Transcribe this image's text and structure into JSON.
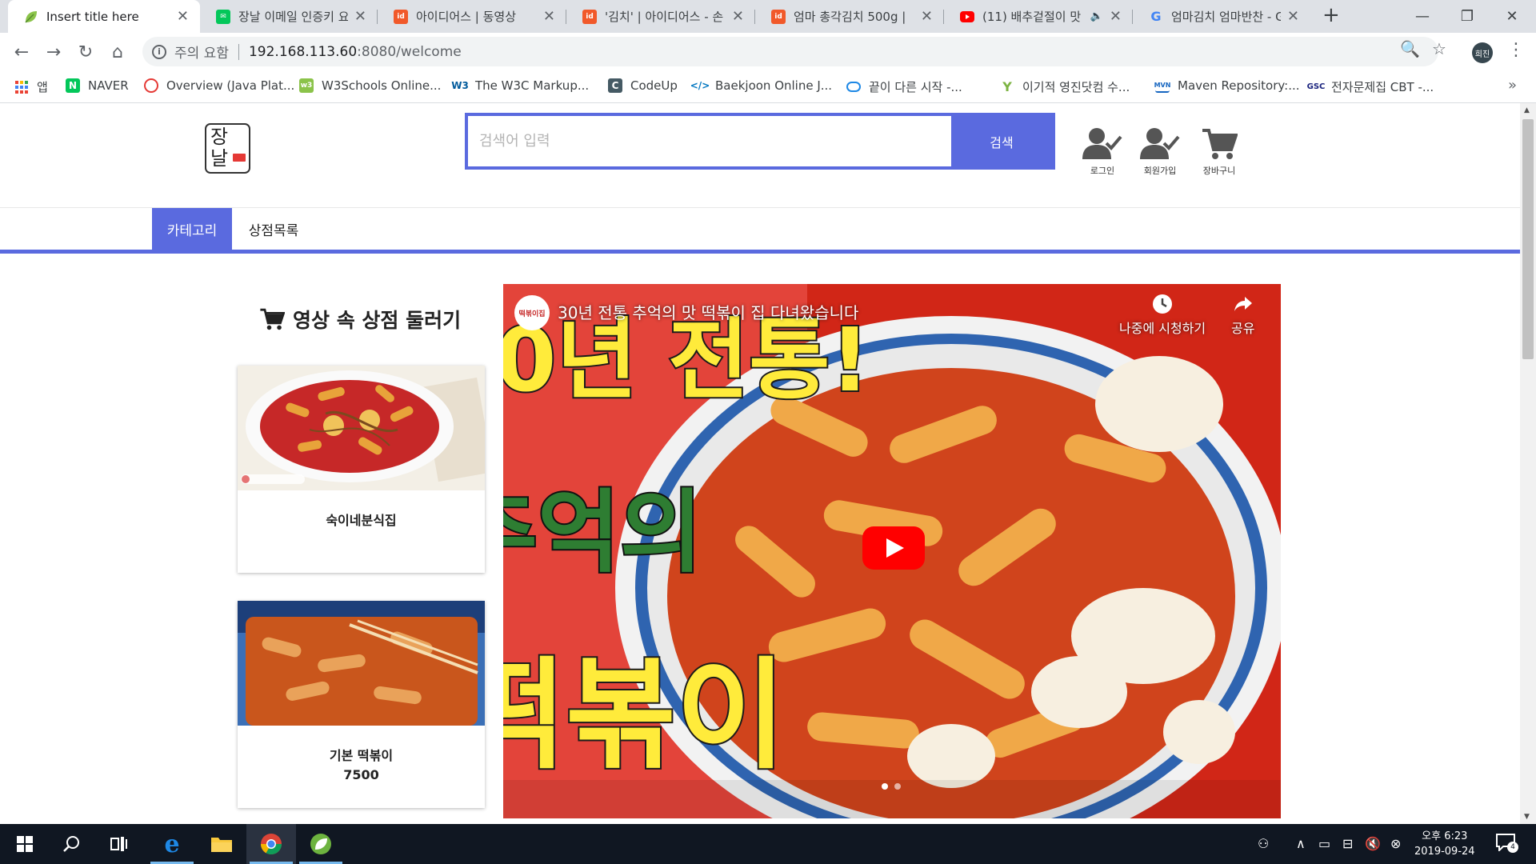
{
  "browser": {
    "tabs": [
      {
        "title": "Insert title here",
        "icon": "leaf-icon",
        "active": true
      },
      {
        "title": "장날 이메일 인증키 요",
        "icon": "naver-icon"
      },
      {
        "title": "아이디어스 | 동영상",
        "icon": "idus-icon"
      },
      {
        "title": "'김치' | 아이디어스 - 손",
        "icon": "idus-icon"
      },
      {
        "title": "엄마 총각김치 500g |",
        "icon": "idus-icon"
      },
      {
        "title": "(11) 배추겉절이 맛",
        "icon": "youtube-icon"
      },
      {
        "title": "엄마김치 엄마반찬 - G",
        "icon": "google-icon"
      }
    ],
    "address": {
      "warning": "주의 요함",
      "host": "192.168.113.60",
      "path": ":8080/welcome"
    },
    "profile_initials": "희진",
    "bookmarks": [
      {
        "label": "앱",
        "icon": "apps-grid-icon"
      },
      {
        "label": "NAVER",
        "icon": "naver-icon"
      },
      {
        "label": "Overview (Java Plat...",
        "icon": "oracle-icon"
      },
      {
        "label": "W3Schools Online...",
        "icon": "w3schools-icon"
      },
      {
        "label": "The W3C Markup...",
        "icon": "w3c-icon"
      },
      {
        "label": "CodeUp",
        "icon": "codeup-icon"
      },
      {
        "label": "Baekjoon Online J...",
        "icon": "code-brackets-icon"
      },
      {
        "label": "끝이 다른 시작 -...",
        "icon": "chat-bubble-icon"
      },
      {
        "label": "이기적 영진닷컴 수...",
        "icon": "y-icon"
      },
      {
        "label": "Maven Repository:...",
        "icon": "mvn-icon"
      },
      {
        "label": "전자문제집 CBT -...",
        "icon": "gsc-icon"
      }
    ]
  },
  "site": {
    "logo_text": [
      "장",
      "날"
    ],
    "search": {
      "placeholder": "검색어 입력",
      "button": "검색"
    },
    "header_icons": [
      {
        "label": "로그인",
        "icon": "user-check-icon"
      },
      {
        "label": "회원가입",
        "icon": "user-check-icon"
      },
      {
        "label": "장바구니",
        "icon": "cart-icon"
      }
    ],
    "nav": [
      {
        "label": "카테고리",
        "active": true
      },
      {
        "label": "상점목록",
        "active": false
      }
    ],
    "section_title": "영상 속 상점 둘러기",
    "cards": [
      {
        "name": "숙이네분식집",
        "price": ""
      },
      {
        "name": "기본 떡볶이",
        "price": "7500"
      }
    ],
    "video": {
      "channel": "떡볶이집",
      "title": "30년 전통 추억의 맛 떡볶이 집 다녀왔습니다",
      "watch_later": "나중에 시청하기",
      "share": "공유",
      "overlay_text": [
        "0년 전통!",
        "추억의",
        "떡볶이"
      ],
      "slide_count": 2,
      "active_slide": 1
    }
  },
  "taskbar": {
    "clock": {
      "period_time": "오후 6:23",
      "date": "2019-09-24"
    },
    "notification_count": "4"
  },
  "colors": {
    "accent": "#5a6adf",
    "taskbar": "#101722"
  }
}
